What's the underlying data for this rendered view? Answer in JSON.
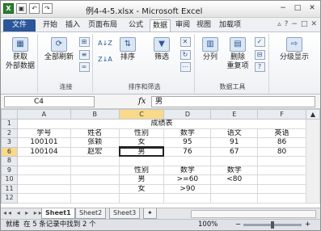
{
  "window": {
    "title": "例4-4-5.xlsx - Microsoft Excel",
    "controls": {
      "minimize": "−",
      "restore": "□",
      "close": "✕"
    }
  },
  "quick_access": {
    "excel_icon": "X",
    "save_icon": "▣",
    "undo_icon": "↶",
    "redo_icon": "↷"
  },
  "tabs": {
    "file": "文件",
    "items": [
      "开始",
      "插入",
      "页面布局",
      "公式",
      "数据",
      "审阅",
      "视图",
      "加载项"
    ],
    "active": "数据"
  },
  "ribbon": {
    "get_external": {
      "line1": "获取",
      "line2": "外部数据",
      "icon": "table-icon"
    },
    "connections": {
      "refresh_all": "全部刷新",
      "group_label": "连接"
    },
    "sort_filter": {
      "sort_az": "A↓Z",
      "sort_za": "Z↓A",
      "sort": "排序",
      "filter": "筛选",
      "group_label": "排序和筛选"
    },
    "data_tools": {
      "split": "分列",
      "remove_dup_line1": "删除",
      "remove_dup_line2": "重复项",
      "group_label": "数据工具"
    },
    "outline": {
      "label": "分级显示"
    }
  },
  "formula_bar": {
    "name_box": "C4",
    "fx": "fx",
    "value": "男"
  },
  "columns": [
    "A",
    "B",
    "C",
    "D",
    "E",
    "F"
  ],
  "rows": [
    {
      "num": "1",
      "cells": [
        "",
        "",
        "成绩表",
        "",
        "",
        ""
      ]
    },
    {
      "num": "2",
      "cells": [
        "学号",
        "姓名",
        "性别",
        "数学",
        "语文",
        "英语"
      ]
    },
    {
      "num": "3",
      "cells": [
        "100101",
        "张颖",
        "女",
        "95",
        "91",
        "86"
      ]
    },
    {
      "num": "6",
      "cells": [
        "100104",
        "赵宏",
        "男",
        "76",
        "67",
        "80"
      ]
    },
    {
      "num": "8",
      "cells": [
        "",
        "",
        "",
        "",
        "",
        ""
      ]
    },
    {
      "num": "9",
      "cells": [
        "",
        "",
        "性别",
        "数学",
        "数学",
        ""
      ]
    },
    {
      "num": "10",
      "cells": [
        "",
        "",
        "男",
        ">=60",
        "<80",
        ""
      ]
    },
    {
      "num": "11",
      "cells": [
        "",
        "",
        "女",
        ">90",
        "",
        ""
      ]
    },
    {
      "num": "12",
      "cells": [
        "",
        "",
        "",
        "",
        "",
        ""
      ]
    }
  ],
  "sheet_tabs": [
    "Sheet1",
    "Sheet2",
    "Sheet3"
  ],
  "active_sheet": "Sheet1",
  "status": {
    "state": "就绪",
    "message": "在 5 条记录中找到 2 个",
    "zoom": "100%",
    "zoom_minus": "−",
    "zoom_plus": "+"
  }
}
